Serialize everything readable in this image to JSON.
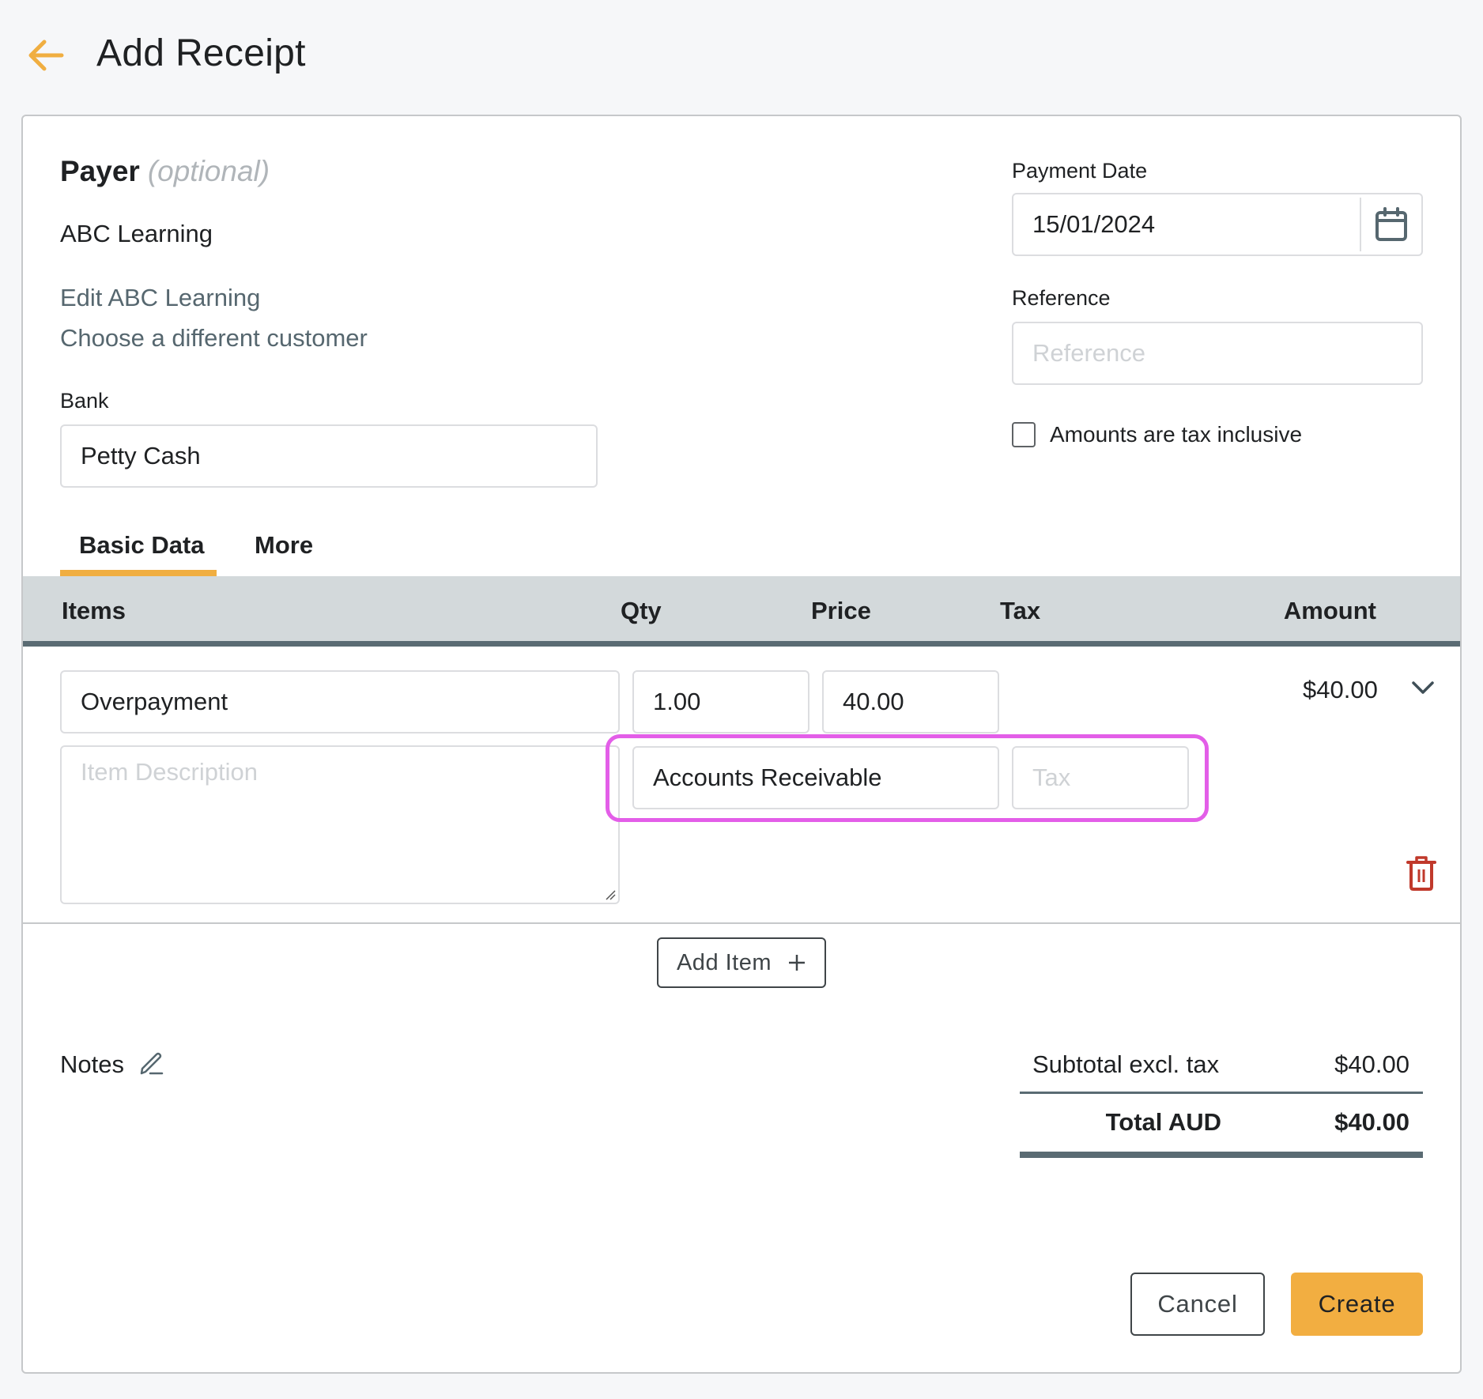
{
  "header": {
    "title": "Add Receipt",
    "back_icon": "arrow-left-icon"
  },
  "colors": {
    "accent": "#f2ae41",
    "link": "#56676f",
    "table_header_bg": "#d3d9db",
    "table_header_border": "#5a6b73",
    "highlight": "#e35ee8",
    "danger": "#c0392b"
  },
  "payer": {
    "title": "Payer",
    "optional_label": "(optional)",
    "name": "ABC Learning",
    "edit_link": "Edit ABC Learning",
    "choose_link": "Choose a different customer"
  },
  "bank": {
    "label": "Bank",
    "value": "Petty Cash"
  },
  "payment_date": {
    "label": "Payment Date",
    "value": "15/01/2024",
    "icon": "calendar-icon"
  },
  "reference": {
    "label": "Reference",
    "value": "",
    "placeholder": "Reference"
  },
  "tax_inclusive": {
    "label": "Amounts are tax inclusive",
    "checked": false
  },
  "tabs": [
    {
      "label": "Basic Data",
      "active": true
    },
    {
      "label": "More",
      "active": false
    }
  ],
  "table": {
    "columns": [
      "Items",
      "Qty",
      "Price",
      "Tax",
      "Amount"
    ],
    "rows": [
      {
        "item": "Overpayment",
        "qty": "1.00",
        "price": "40.00",
        "amount": "$40.00",
        "description": "",
        "description_placeholder": "Item Description",
        "account": "Accounts Receivable",
        "tax": "",
        "tax_placeholder": "Tax"
      }
    ]
  },
  "add_item": {
    "label": "Add Item",
    "icon": "plus-icon"
  },
  "notes": {
    "label": "Notes",
    "icon": "pencil-icon"
  },
  "totals": {
    "subtotal_label": "Subtotal excl. tax",
    "subtotal_value": "$40.00",
    "total_label": "Total AUD",
    "total_value": "$40.00"
  },
  "footer": {
    "cancel_label": "Cancel",
    "create_label": "Create"
  }
}
